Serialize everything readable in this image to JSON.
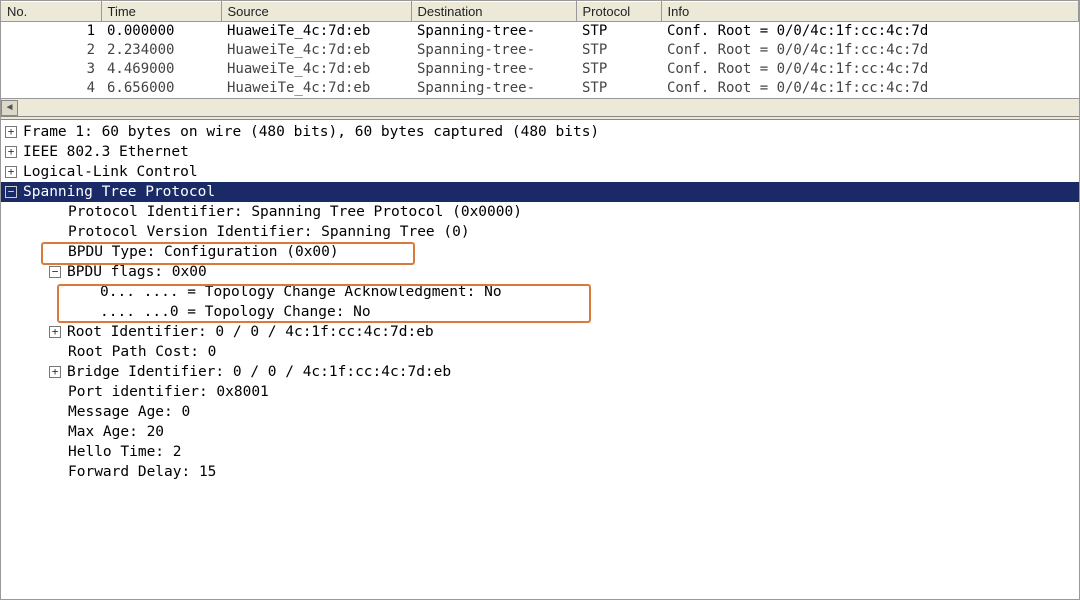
{
  "columns": {
    "no": "No.",
    "time": "Time",
    "source": "Source",
    "destination": "Destination",
    "protocol": "Protocol",
    "info": "Info"
  },
  "packets": [
    {
      "no": "1",
      "time": "0.000000",
      "source": "HuaweiTe_4c:7d:eb",
      "destination": "Spanning-tree-",
      "protocol": "STP",
      "info": "Conf. Root = 0/0/4c:1f:cc:4c:7d"
    },
    {
      "no": "2",
      "time": "2.234000",
      "source": "HuaweiTe_4c:7d:eb",
      "destination": "Spanning-tree-",
      "protocol": "STP",
      "info": "Conf. Root = 0/0/4c:1f:cc:4c:7d"
    },
    {
      "no": "3",
      "time": "4.469000",
      "source": "HuaweiTe_4c:7d:eb",
      "destination": "Spanning-tree-",
      "protocol": "STP",
      "info": "Conf. Root = 0/0/4c:1f:cc:4c:7d"
    },
    {
      "no": "4",
      "time": "6.656000",
      "source": "HuaweiTe_4c:7d:eb",
      "destination": "Spanning-tree-",
      "protocol": "STP",
      "info": "Conf. Root = 0/0/4c:1f:cc:4c:7d"
    }
  ],
  "details": {
    "frame": "Frame 1: 60 bytes on wire (480 bits), 60 bytes captured (480 bits)",
    "ieee": "IEEE 802.3 Ethernet",
    "llc": "Logical-Link Control",
    "stp": "Spanning Tree Protocol",
    "protoid": "Protocol Identifier: Spanning Tree Protocol (0x0000)",
    "protver": "Protocol Version Identifier: Spanning Tree (0)",
    "bpdu_type": "BPDU Type: Configuration (0x00)",
    "bpdu_flags": "BPDU flags: 0x00",
    "flag_tca": "0... .... = Topology Change Acknowledgment: No",
    "flag_tc": ".... ...0 = Topology Change: No",
    "root_id": "Root Identifier: 0 / 0 / 4c:1f:cc:4c:7d:eb",
    "root_cost": "Root Path Cost: 0",
    "bridge_id": "Bridge Identifier: 0 / 0 / 4c:1f:cc:4c:7d:eb",
    "port_id": "Port identifier: 0x8001",
    "msg_age": "Message Age: 0",
    "max_age": "Max Age: 20",
    "hello": "Hello Time: 2",
    "fwd_delay": "Forward Delay: 15"
  },
  "icons": {
    "plus": "+",
    "minus": "−",
    "larrow": "◄"
  }
}
